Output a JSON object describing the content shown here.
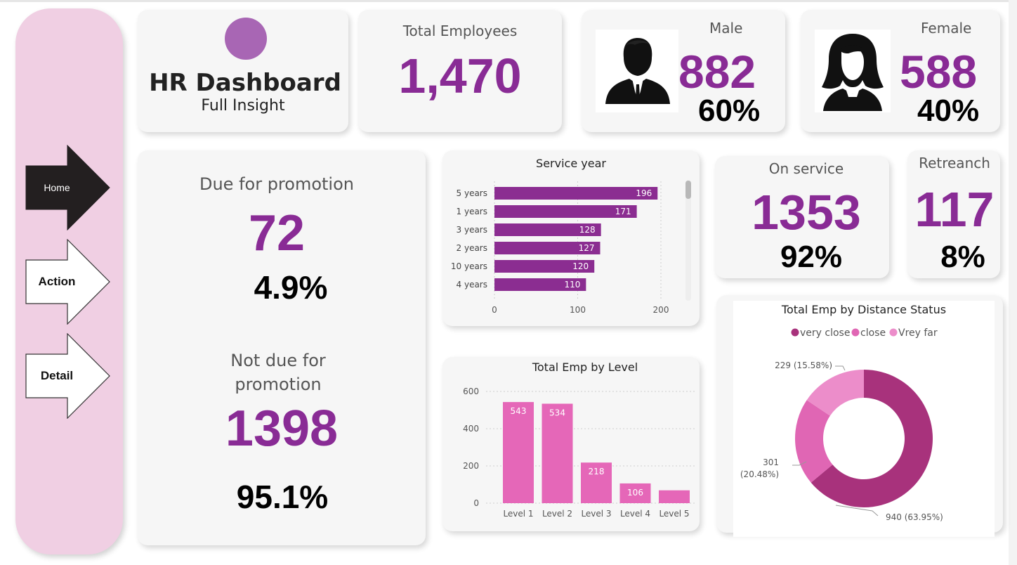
{
  "nav": {
    "home_label": "Home",
    "action_label": "Action",
    "detail_label": "Detail"
  },
  "header": {
    "title": "HR Dashboard",
    "subtitle": "Full Insight"
  },
  "total_employees": {
    "label": "Total Employees",
    "value": "1,470"
  },
  "male": {
    "label": "Male",
    "value": "882",
    "percent": "60%"
  },
  "female": {
    "label": "Female",
    "value": "588",
    "percent": "40%"
  },
  "promotion": {
    "due_label": "Due for promotion",
    "due_value": "72",
    "due_percent": "4.9%",
    "not_due_label_1": "Not due for",
    "not_due_label_2": "promotion",
    "not_due_value": "1398",
    "not_due_percent": "95.1%"
  },
  "on_service": {
    "label": "On service",
    "value": "1353",
    "percent": "92%"
  },
  "retrench": {
    "label": "Retreanch",
    "value": "117",
    "percent": "8%"
  },
  "colors": {
    "purple": "#892b95",
    "bar_purple": "#8b2d91",
    "level_pink": "#e567b8",
    "donut_very_close": "#a8327c",
    "donut_close": "#e066b4",
    "donut_very_far": "#ec8dca",
    "sidebar": "#f0cfe3"
  },
  "chart_data": [
    {
      "type": "bar",
      "orientation": "horizontal",
      "title": "Service year",
      "categories": [
        "5 years",
        "1 years",
        "3 years",
        "2 years",
        "10 years",
        "4 years"
      ],
      "values": [
        196,
        171,
        128,
        127,
        120,
        110
      ],
      "xlim": [
        0,
        200
      ],
      "xticks": [
        "0",
        "100",
        "200"
      ],
      "grid": true
    },
    {
      "type": "bar",
      "title": "Total Emp by Level",
      "categories": [
        "Level 1",
        "Level 2",
        "Level 3",
        "Level 4",
        "Level 5"
      ],
      "values": [
        543,
        534,
        218,
        106,
        69
      ],
      "data_labels": [
        "543",
        "534",
        "218",
        "106",
        ""
      ],
      "ylim": [
        0,
        600
      ],
      "yticks": [
        "0",
        "200",
        "400",
        "600"
      ],
      "grid": true
    },
    {
      "type": "pie",
      "donut": true,
      "title": "Total Emp by Distance Status",
      "legend_position": "top",
      "labels": [
        "very close",
        "close",
        "Vrey far"
      ],
      "values": [
        940,
        301,
        229
      ],
      "data_labels": [
        "940 (63.95%)",
        "301 (20.48%)",
        "229 (15.58%)"
      ],
      "data_label_lines": [
        [
          "301"
        ],
        [
          "(20.48%)"
        ]
      ]
    }
  ]
}
